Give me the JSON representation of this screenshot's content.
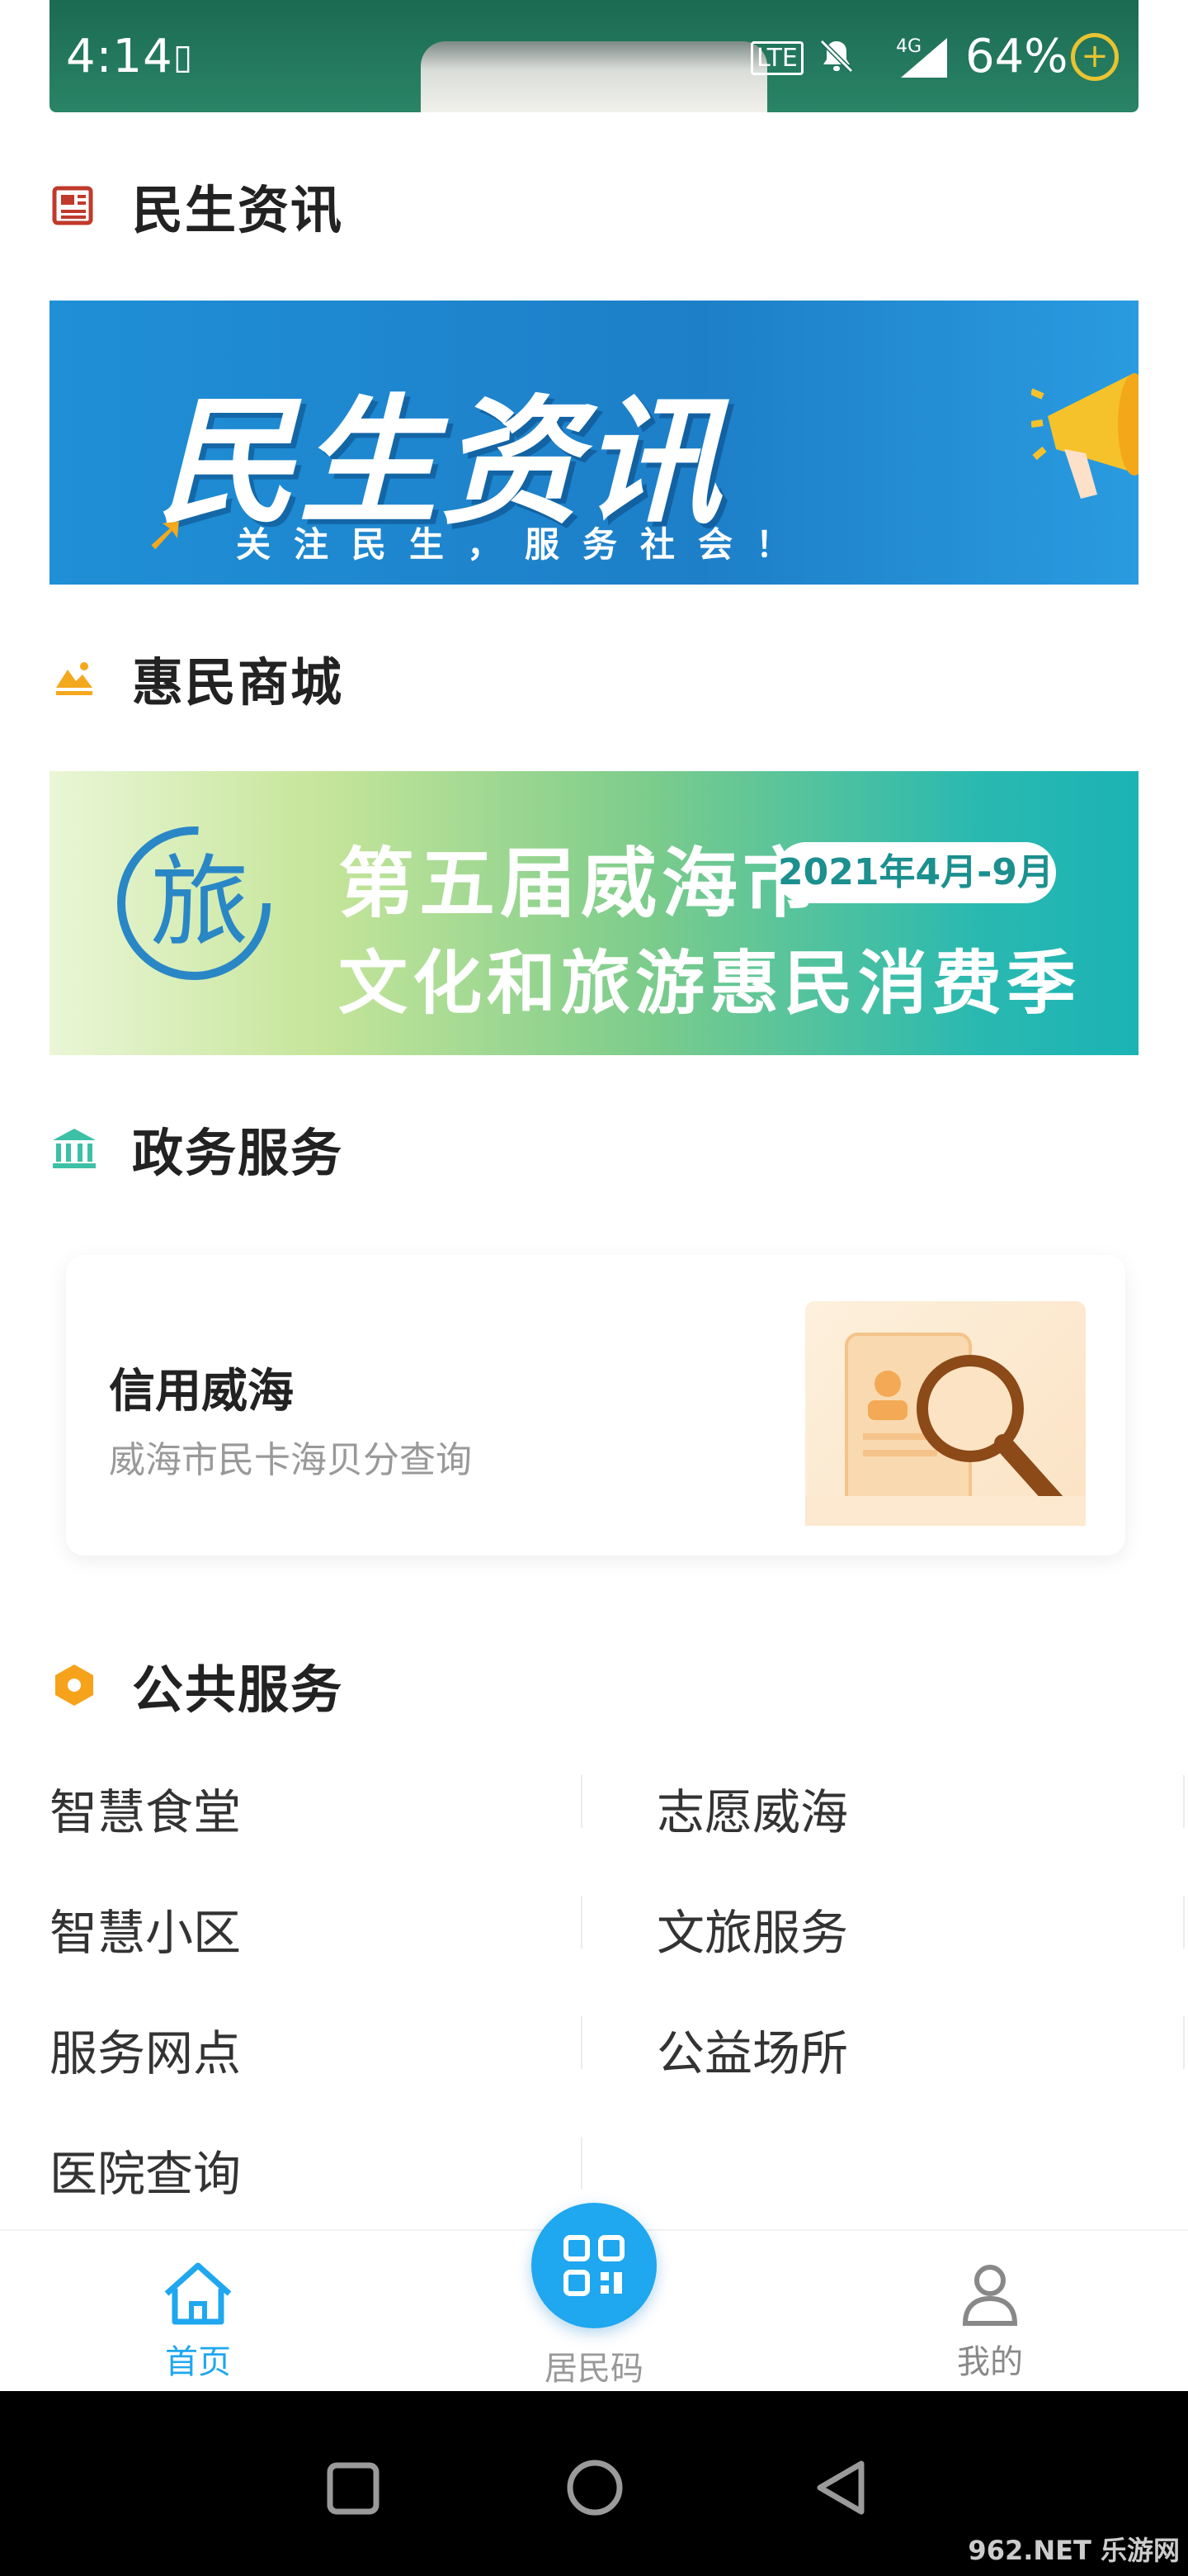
{
  "status_bar": {
    "time": "4:14",
    "battery": "64%",
    "network": "4G"
  },
  "sections": {
    "news": {
      "title": "民生资讯",
      "icon": "newspaper-icon"
    },
    "mall": {
      "title": "惠民商城",
      "icon": "mountain-icon"
    },
    "gov": {
      "title": "政务服务",
      "icon": "bank-icon"
    },
    "public": {
      "title": "公共服务",
      "icon": "hexagon-icon"
    }
  },
  "banners": {
    "news_banner": {
      "headline": "民生资讯",
      "slogan": "关注民生，服务社会！"
    },
    "mall_banner": {
      "logo_text": "旅",
      "line1": "第五届威海市",
      "line2": "文化和旅游惠民消费季",
      "date": "2021年4月-9月"
    }
  },
  "gov_card": {
    "title": "信用威海",
    "subtitle": "威海市民卡海贝分查询"
  },
  "public_services": [
    "智慧食堂",
    "志愿威海",
    "智慧小区",
    "文旅服务",
    "服务网点",
    "公益场所",
    "医院查询"
  ],
  "bottom_nav": {
    "home": "首页",
    "qr": "居民码",
    "mine": "我的"
  },
  "colors": {
    "accent_blue": "#1fa7ef",
    "news_red": "#c0392b",
    "mall_orange": "#f4a81d",
    "gov_teal": "#3cc0a6",
    "public_orange": "#f7a21b"
  },
  "watermark": "962.NET 乐游网"
}
